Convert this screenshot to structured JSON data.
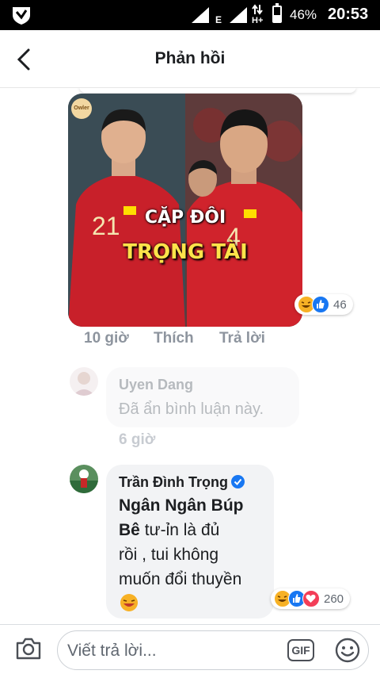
{
  "status_bar": {
    "network_type": "E",
    "data_type": "H+",
    "battery_percent": "46%",
    "battery_level": 0.46,
    "time": "20:53"
  },
  "header": {
    "title": "Phản hồi",
    "back_icon": "chevron-left-icon"
  },
  "post": {
    "image_overlay_line1": "CẶP ĐÔI",
    "image_overlay_line2": "TRỌNG TÀI",
    "image_watermark": "Owler",
    "jersey_left": "21",
    "jersey_right": "4",
    "reactions": [
      "haha-icon",
      "like-icon"
    ],
    "reaction_count": "46",
    "time": "10 giờ",
    "like_label": "Thích",
    "reply_label": "Trả lời"
  },
  "comments": [
    {
      "author": "Uyen Dang",
      "text": "Đã ẩn bình luận này.",
      "time": "6 giờ"
    },
    {
      "author": "Trần Đình Trọng",
      "verified": true,
      "text_bold": "Ngân Ngân Búp Bê",
      "text_line1_rest": "tư-ỉn là đủ",
      "text_line2": "rồi , tui không",
      "text_line3": "muốn đổi thuyền",
      "reactions": [
        "haha-icon",
        "like-icon",
        "love-icon"
      ],
      "reaction_count": "260"
    }
  ],
  "composer": {
    "placeholder": "Viết trả lời...",
    "gif_label": "GIF",
    "camera_icon": "camera-icon",
    "emoji_icon": "smiley-icon"
  },
  "colors": {
    "accent": "#1877f2",
    "love": "#f33e58",
    "haha": "#f7b125",
    "meta_text": "#8d949e"
  }
}
